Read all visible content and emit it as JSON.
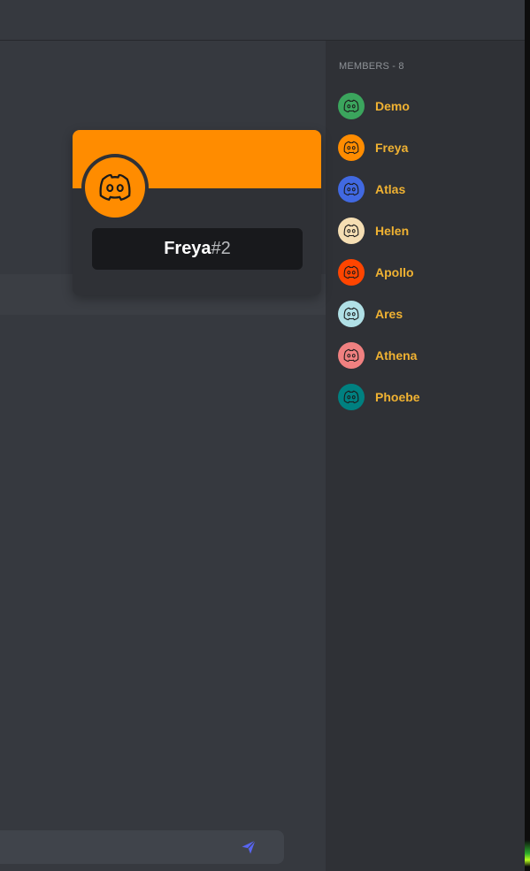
{
  "members": {
    "header": "MEMBERS - 8",
    "name_color": "#f0b232",
    "list": [
      {
        "name": "Demo",
        "avatar_color": "#3ba55d",
        "icon": "discord-logo-icon"
      },
      {
        "name": "Freya",
        "avatar_color": "#ff8c00",
        "icon": "discord-logo-icon"
      },
      {
        "name": "Atlas",
        "avatar_color": "#4169e1",
        "icon": "discord-logo-icon"
      },
      {
        "name": "Helen",
        "avatar_color": "#f5deb3",
        "icon": "discord-logo-icon"
      },
      {
        "name": "Apollo",
        "avatar_color": "#ff4500",
        "icon": "discord-logo-icon"
      },
      {
        "name": "Ares",
        "avatar_color": "#b0e0e6",
        "icon": "discord-logo-icon"
      },
      {
        "name": "Athena",
        "avatar_color": "#f08080",
        "icon": "discord-logo-icon"
      },
      {
        "name": "Phoebe",
        "avatar_color": "#008080",
        "icon": "discord-logo-icon"
      }
    ]
  },
  "profile_popout": {
    "banner_color": "#ff8c00",
    "avatar_color": "#ff8c00",
    "username": "Freya",
    "discriminator": "#2"
  },
  "composer": {
    "send_icon": "send-icon",
    "send_color": "#5865f2"
  }
}
